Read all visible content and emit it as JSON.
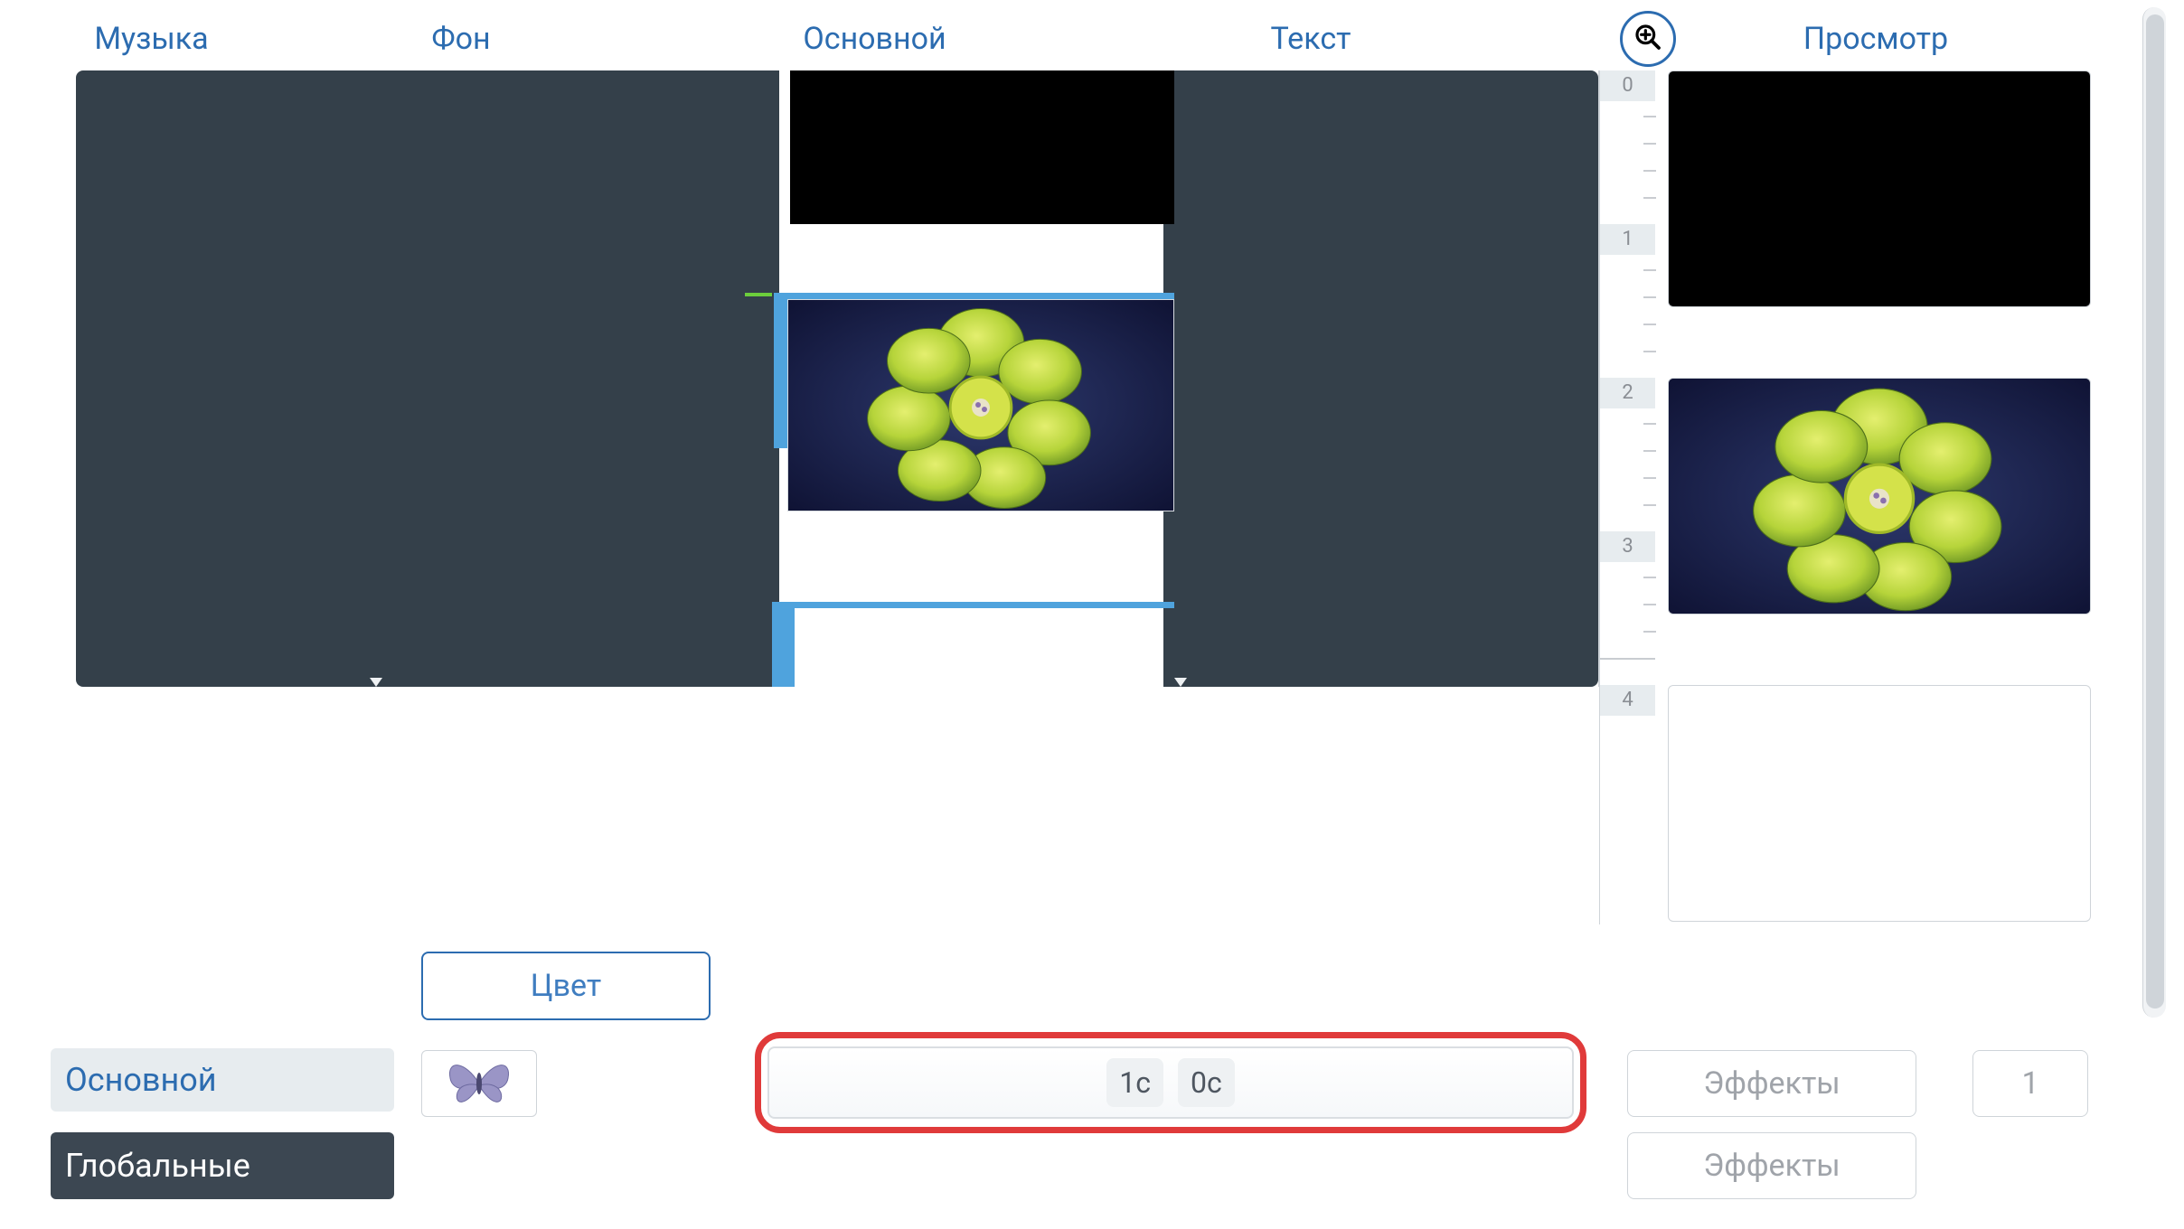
{
  "tabs": {
    "music": "Музыка",
    "bg": "Фон",
    "main": "Основной",
    "text": "Текст",
    "preview": "Просмотр"
  },
  "ruler": {
    "labels": [
      "0",
      "1",
      "2",
      "3",
      "4"
    ]
  },
  "buttons": {
    "color": "Цвет",
    "main": "Основной",
    "global": "Глобальные",
    "effects": "Эффекты",
    "count": "1"
  },
  "timing": {
    "in": "1с",
    "out": "0с"
  },
  "slides": [
    {
      "kind": "black"
    },
    {
      "kind": "plant"
    },
    {
      "kind": "white"
    }
  ]
}
